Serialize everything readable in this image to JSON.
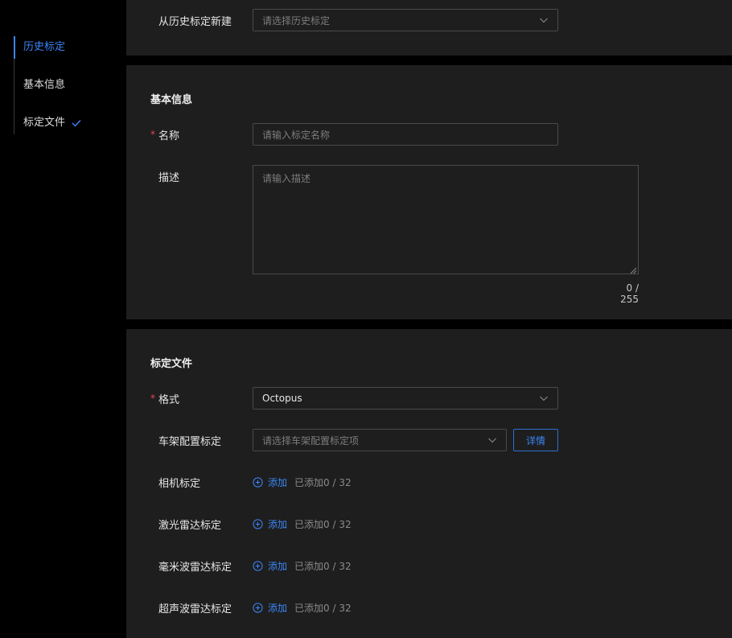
{
  "nav": {
    "items": [
      {
        "label": "历史标定"
      },
      {
        "label": "基本信息"
      },
      {
        "label": "标定文件"
      }
    ]
  },
  "history": {
    "label": "从历史标定新建",
    "placeholder": "请选择历史标定"
  },
  "basic": {
    "title": "基本信息",
    "name_label": "名称",
    "name_placeholder": "请输入标定名称",
    "desc_label": "描述",
    "desc_placeholder": "请输入描述",
    "desc_counter": "0 / 255"
  },
  "calib": {
    "title": "标定文件",
    "format_label": "格式",
    "format_value": "Octopus",
    "frame_label": "车架配置标定",
    "frame_placeholder": "请选择车架配置标定项",
    "detail_label": "详情",
    "add_label": "添加",
    "rows": [
      {
        "label": "相机标定",
        "count": "已添加0 / 32"
      },
      {
        "label": "激光雷达标定",
        "count": "已添加0 / 32"
      },
      {
        "label": "毫米波雷达标定",
        "count": "已添加0 / 32"
      },
      {
        "label": "超声波雷达标定",
        "count": "已添加0 / 32"
      }
    ]
  },
  "colors": {
    "accent": "#3b86f7",
    "required": "#e5484d",
    "panel": "#1e1e1e",
    "background": "#000000"
  }
}
